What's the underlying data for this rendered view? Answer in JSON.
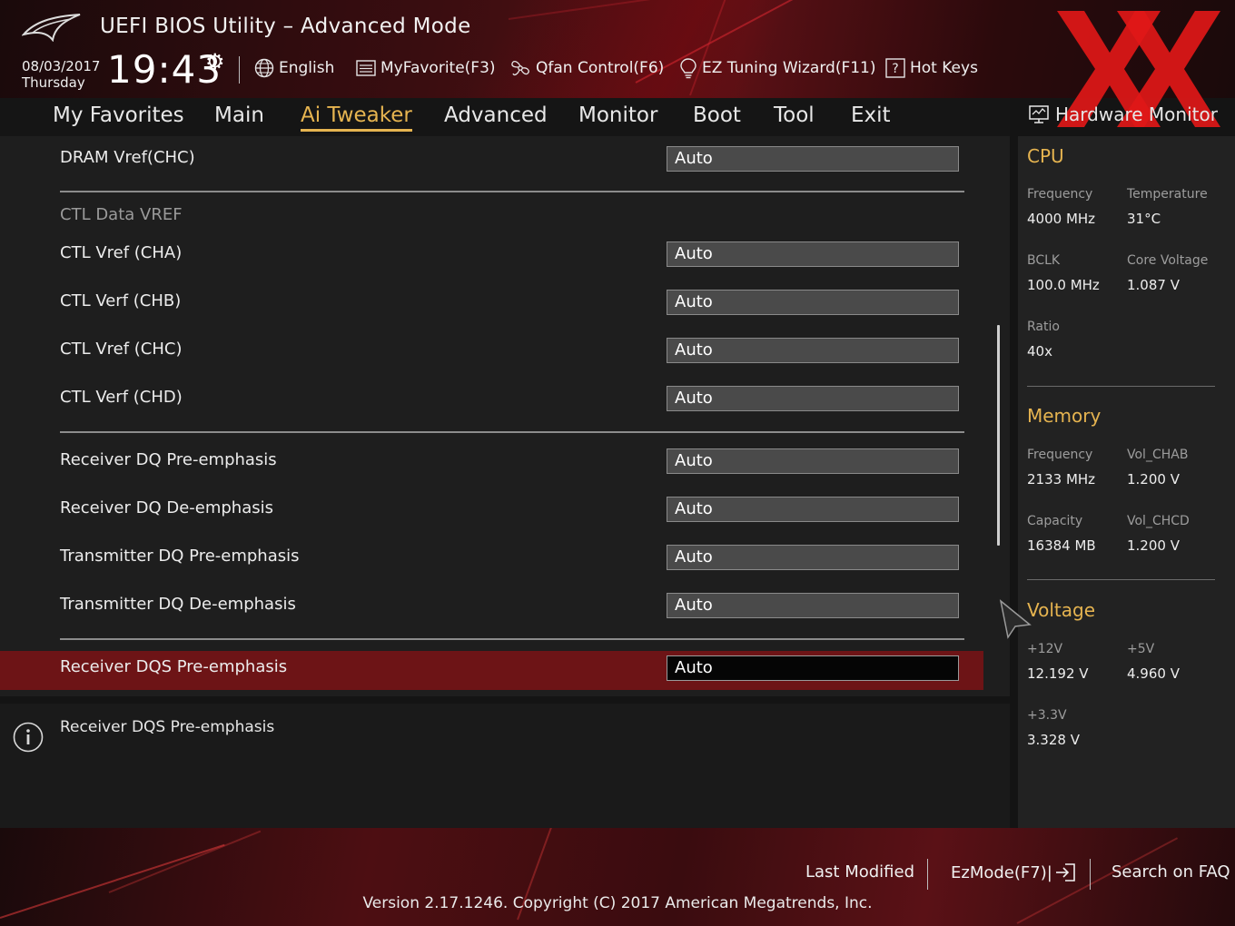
{
  "app": {
    "title": "UEFI BIOS Utility – Advanced Mode"
  },
  "clock": {
    "date": "08/03/2017",
    "day": "Thursday",
    "time": "19:43"
  },
  "toolbar": {
    "language": "English",
    "favorite": "MyFavorite(F3)",
    "qfan": "Qfan Control(F6)",
    "tuning": "EZ Tuning Wizard(F11)",
    "hotkeys": "Hot Keys"
  },
  "nav": {
    "tabs": [
      "My Favorites",
      "Main",
      "Ai Tweaker",
      "Advanced",
      "Monitor",
      "Boot",
      "Tool",
      "Exit"
    ],
    "active": "Ai Tweaker"
  },
  "settings": [
    {
      "label": "DRAM Vref(CHC)",
      "value": "Auto"
    },
    {
      "label": "CTL Data VREF",
      "value": ""
    },
    {
      "label": "CTL Vref (CHA)",
      "value": "Auto"
    },
    {
      "label": "CTL Verf (CHB)",
      "value": "Auto"
    },
    {
      "label": "CTL Vref (CHC)",
      "value": "Auto"
    },
    {
      "label": "CTL Verf (CHD)",
      "value": "Auto"
    },
    {
      "label": "Receiver DQ Pre-emphasis",
      "value": "Auto"
    },
    {
      "label": "Receiver DQ De-emphasis",
      "value": "Auto"
    },
    {
      "label": "Transmitter DQ Pre-emphasis",
      "value": "Auto"
    },
    {
      "label": "Transmitter DQ De-emphasis",
      "value": "Auto"
    },
    {
      "label": "Receiver DQS Pre-emphasis",
      "value": "Auto"
    }
  ],
  "help": {
    "text": "Receiver DQS Pre-emphasis"
  },
  "hw": {
    "title": "Hardware Monitor",
    "cpu": {
      "heading": "CPU",
      "frequency_label": "Frequency",
      "frequency": "4000 MHz",
      "temperature_label": "Temperature",
      "temperature": "31°C",
      "bclk_label": "BCLK",
      "bclk": "100.0 MHz",
      "core_voltage_label": "Core Voltage",
      "core_voltage": "1.087 V",
      "ratio_label": "Ratio",
      "ratio": "40x"
    },
    "memory": {
      "heading": "Memory",
      "frequency_label": "Frequency",
      "frequency": "2133 MHz",
      "vol_chab_label": "Vol_CHAB",
      "vol_chab": "1.200 V",
      "capacity_label": "Capacity",
      "capacity": "16384 MB",
      "vol_chcd_label": "Vol_CHCD",
      "vol_chcd": "1.200 V"
    },
    "voltage": {
      "heading": "Voltage",
      "v12_label": "+12V",
      "v12": "12.192 V",
      "v5_label": "+5V",
      "v5": "4.960 V",
      "v33_label": "+3.3V",
      "v33": "3.328 V"
    }
  },
  "footer": {
    "last_modified": "Last Modified",
    "ezmode": "EzMode(F7)|",
    "faq": "Search on FAQ",
    "version": "Version 2.17.1246. Copyright (C) 2017 American Megatrends, Inc."
  },
  "colors": {
    "accent": "#e6b450",
    "selected_row": "#6d1416",
    "watermark": "#e01818"
  }
}
